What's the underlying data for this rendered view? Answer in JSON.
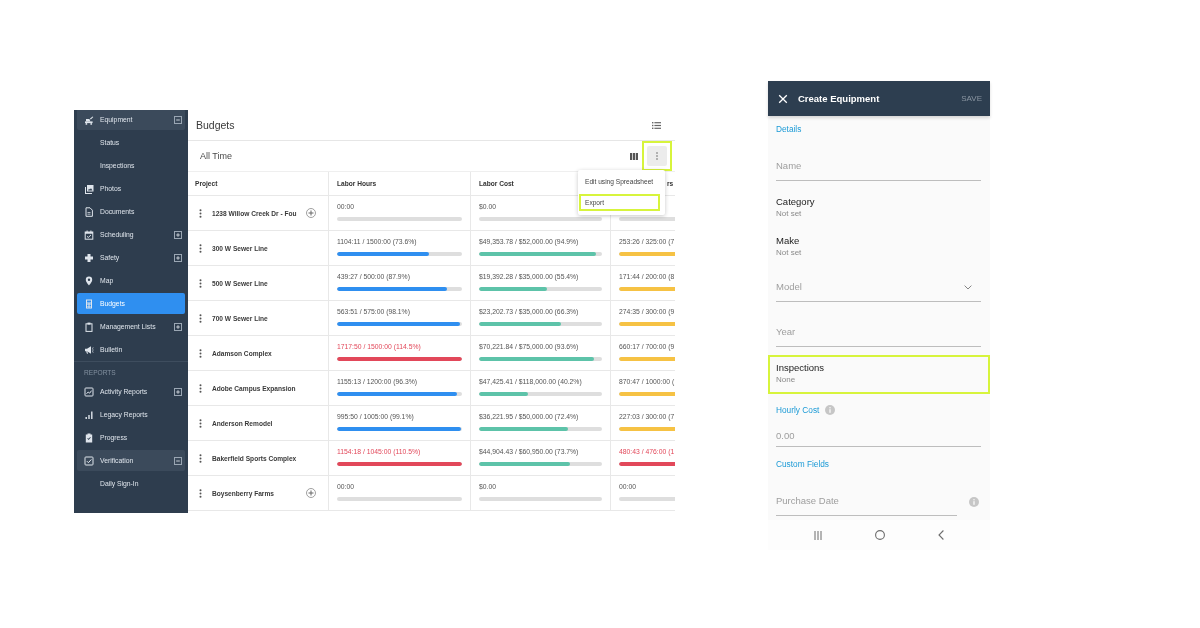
{
  "sidebar": {
    "sections": [
      {
        "items": [
          {
            "label": "Equipment",
            "kind": "group",
            "expanded": true,
            "selected": false,
            "children": [
              {
                "label": "Status",
                "selected": false
              },
              {
                "label": "Inspections",
                "selected": false
              }
            ]
          },
          {
            "label": "Photos",
            "kind": "link",
            "selected": false
          },
          {
            "label": "Documents",
            "kind": "link",
            "selected": false
          },
          {
            "label": "Scheduling",
            "kind": "group",
            "expanded": false,
            "selected": false
          },
          {
            "label": "Safety",
            "kind": "group",
            "expanded": false,
            "selected": false
          },
          {
            "label": "Map",
            "kind": "link",
            "selected": false
          },
          {
            "label": "Budgets",
            "kind": "link",
            "selected": true
          },
          {
            "label": "Management Lists",
            "kind": "group",
            "expanded": false,
            "selected": false
          },
          {
            "label": "Bulletin",
            "kind": "link",
            "selected": false
          }
        ]
      },
      {
        "heading": "REPORTS",
        "items": [
          {
            "label": "Activity Reports",
            "kind": "group",
            "expanded": false,
            "selected": false
          },
          {
            "label": "Legacy Reports",
            "kind": "link",
            "selected": false
          },
          {
            "label": "Progress",
            "kind": "link",
            "selected": false
          },
          {
            "label": "Verification",
            "kind": "group",
            "expanded": true,
            "selected": false,
            "children": [
              {
                "label": "Daily Sign-In",
                "selected": false
              }
            ]
          }
        ]
      }
    ]
  },
  "main": {
    "title": "Budgets",
    "filter": "All Time",
    "more_button": {
      "highlighted": true
    },
    "menu": {
      "items": [
        {
          "label": "Edit using Spreadsheet",
          "highlighted": false
        },
        {
          "label": "Export",
          "highlighted": true
        }
      ]
    },
    "table": {
      "columns": [
        {
          "label": "Project"
        },
        {
          "label": "Labor Hours",
          "color": "#2f8ff0"
        },
        {
          "label": "Labor Cost",
          "color": "#5dc3a9"
        },
        {
          "label": "rs",
          "color": "#f6c244"
        }
      ],
      "rows": [
        {
          "cells": [
            {
              "kind": "project",
              "text": "1238 Willow Creek Dr - Fou",
              "addable": true
            },
            {
              "kind": "progress",
              "text": "00:00",
              "over": false
            },
            {
              "kind": "progress",
              "text": "$0.00",
              "over": false
            },
            {
              "kind": "progress"
            }
          ]
        },
        {
          "cells": [
            {
              "kind": "project",
              "text": "300 W Sewer Line",
              "addable": false
            },
            {
              "kind": "progress",
              "text": "1104:11 / 1500:00 (73.6%)",
              "level": 0.736,
              "over": false
            },
            {
              "kind": "progress",
              "text": "$49,353.78 / $52,000.00 (94.9%)",
              "level": 0.949,
              "over": false
            },
            {
              "kind": "progress",
              "text": "253:26 / 325:00 (7",
              "level": 0.78,
              "over": false
            }
          ]
        },
        {
          "cells": [
            {
              "kind": "project",
              "text": "500 W Sewer Line",
              "addable": false
            },
            {
              "kind": "progress",
              "text": "439:27 / 500:00 (87.9%)",
              "level": 0.879,
              "over": false
            },
            {
              "kind": "progress",
              "text": "$19,392.28 / $35,000.00 (55.4%)",
              "level": 0.554,
              "over": false
            },
            {
              "kind": "progress",
              "text": "171:44 / 200:00 (8",
              "level": 0.859,
              "over": false
            }
          ]
        },
        {
          "cells": [
            {
              "kind": "project",
              "text": "700 W Sewer Line",
              "addable": false
            },
            {
              "kind": "progress",
              "text": "563:51 / 575:00 (98.1%)",
              "level": 0.981,
              "over": false
            },
            {
              "kind": "progress",
              "text": "$23,202.73 / $35,000.00 (66.3%)",
              "level": 0.663,
              "over": false
            },
            {
              "kind": "progress",
              "text": "274:35 / 300:00 (9",
              "level": 0.915,
              "over": false
            }
          ]
        },
        {
          "cells": [
            {
              "kind": "project",
              "text": "Adamson Complex",
              "addable": false
            },
            {
              "kind": "progress",
              "text": "1717:50 / 1500:00 (114.5%)",
              "level": 1,
              "over": true
            },
            {
              "kind": "progress",
              "text": "$70,221.84 / $75,000.00 (93.6%)",
              "level": 0.936,
              "over": false
            },
            {
              "kind": "progress",
              "text": "660:17 / 700:00 (9",
              "level": 0.943,
              "over": false
            }
          ]
        },
        {
          "cells": [
            {
              "kind": "project",
              "text": "Adobe Campus Expansion",
              "addable": false
            },
            {
              "kind": "progress",
              "text": "1155:13 / 1200:00 (96.3%)",
              "level": 0.963,
              "over": false
            },
            {
              "kind": "progress",
              "text": "$47,425.41 / $118,000.00 (40.2%)",
              "level": 0.402,
              "over": false
            },
            {
              "kind": "progress",
              "text": "870:47 / 1000:00 (",
              "level": 0.871,
              "over": false
            }
          ]
        },
        {
          "cells": [
            {
              "kind": "project",
              "text": "Anderson Remodel",
              "addable": false
            },
            {
              "kind": "progress",
              "text": "995:50 / 1005:00 (99.1%)",
              "level": 0.991,
              "over": false
            },
            {
              "kind": "progress",
              "text": "$36,221.95 / $50,000.00 (72.4%)",
              "level": 0.724,
              "over": false
            },
            {
              "kind": "progress",
              "text": "227:03 / 300:00 (7",
              "level": 0.757,
              "over": false
            }
          ]
        },
        {
          "cells": [
            {
              "kind": "project",
              "text": "Bakerfield Sports Complex",
              "addable": false
            },
            {
              "kind": "progress",
              "text": "1154:18 / 1045:00 (110.5%)",
              "level": 1,
              "over": true
            },
            {
              "kind": "progress",
              "text": "$44,904.43 / $60,950.00 (73.7%)",
              "level": 0.737,
              "over": false
            },
            {
              "kind": "progress",
              "text": "480:43 / 476:00 (1",
              "level": 1,
              "over": true
            }
          ]
        },
        {
          "cells": [
            {
              "kind": "project",
              "text": "Boysenberry Farms",
              "addable": true
            },
            {
              "kind": "progress",
              "text": "00:00",
              "over": false
            },
            {
              "kind": "progress",
              "text": "$0.00",
              "over": false
            },
            {
              "kind": "progress",
              "text": "00:00",
              "over": false
            }
          ]
        }
      ]
    }
  },
  "form": {
    "title": "Create Equipment",
    "save": {
      "label": "SAVE",
      "disabled": true
    },
    "fields": [
      {
        "kind": "section",
        "label": "Details"
      },
      {
        "kind": "input",
        "placeholder": "Name",
        "info": false
      },
      {
        "kind": "picker",
        "label": "Category",
        "value": "Not set",
        "highlighted": false
      },
      {
        "kind": "picker",
        "label": "Make",
        "value": "Not set",
        "highlighted": false
      },
      {
        "kind": "select",
        "placeholder": "Model"
      },
      {
        "kind": "input",
        "placeholder": "Year",
        "info": false
      },
      {
        "kind": "picker",
        "label": "Inspections",
        "value": "None",
        "highlighted": true
      },
      {
        "kind": "labeled_input",
        "label": "Hourly Cost",
        "placeholder": "0.00",
        "info": true
      },
      {
        "kind": "section",
        "label": "Custom Fields"
      },
      {
        "kind": "input",
        "placeholder": "Purchase Date",
        "info": true
      }
    ]
  }
}
